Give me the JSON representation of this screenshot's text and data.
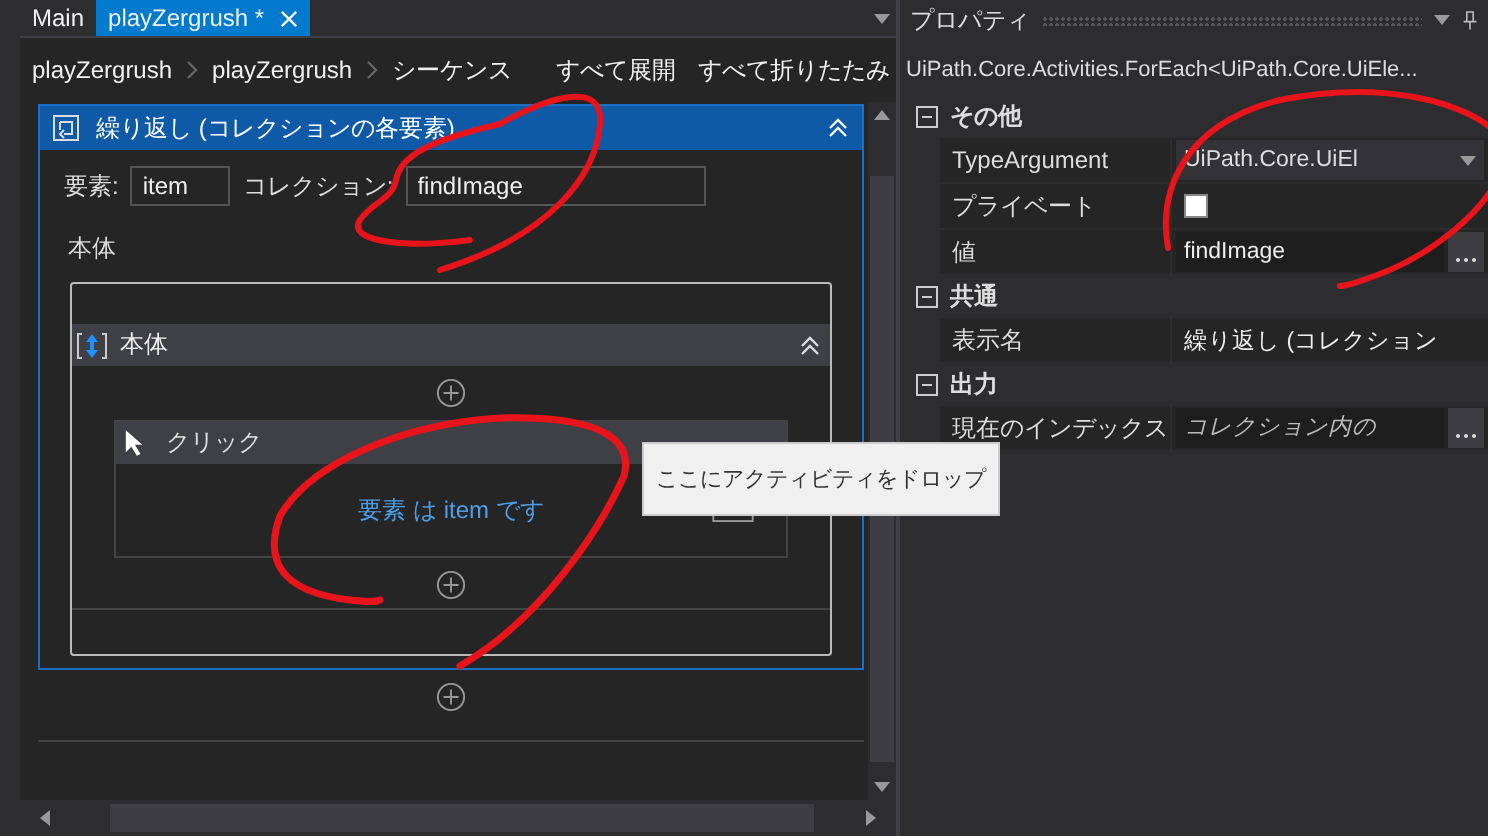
{
  "tabs": [
    {
      "label": "Main",
      "selected": false,
      "closable": false
    },
    {
      "label": "playZergrush *",
      "selected": true,
      "closable": true
    }
  ],
  "breadcrumbs": [
    "playZergrush",
    "playZergrush",
    "シーケンス"
  ],
  "toolbar_links": [
    "すべて展開",
    "すべて折りたたみ"
  ],
  "foreach": {
    "title": "繰り返し (コレクションの各要素)",
    "item_label": "要素:",
    "item_value": "item",
    "collection_label": "コレクション:",
    "collection_value": "findImage",
    "body_label": "本体",
    "sequence": {
      "title": "本体",
      "activity": {
        "title": "クリック",
        "body": "要素 は item です"
      }
    }
  },
  "tooltip": "ここにアクティビティをドロップ",
  "properties": {
    "title": "プロパティ",
    "type_name": "UiPath.Core.Activities.ForEach<UiPath.Core.UiEle...",
    "categories": [
      {
        "name": "その他",
        "expanded": true,
        "rows": [
          {
            "name": "TypeArgument",
            "kind": "dropdown",
            "value": "UiPath.Core.UiEl"
          },
          {
            "name": "プライベート",
            "kind": "checkbox",
            "checked": false
          },
          {
            "name": "値",
            "kind": "expression",
            "value": "findImage"
          }
        ]
      },
      {
        "name": "共通",
        "expanded": true,
        "rows": [
          {
            "name": "表示名",
            "kind": "text",
            "value": "繰り返し (コレクション"
          }
        ]
      },
      {
        "name": "出力",
        "expanded": true,
        "rows": [
          {
            "name": "現在のインデックス",
            "kind": "expression",
            "placeholder": "コレクション内の"
          }
        ]
      }
    ]
  }
}
